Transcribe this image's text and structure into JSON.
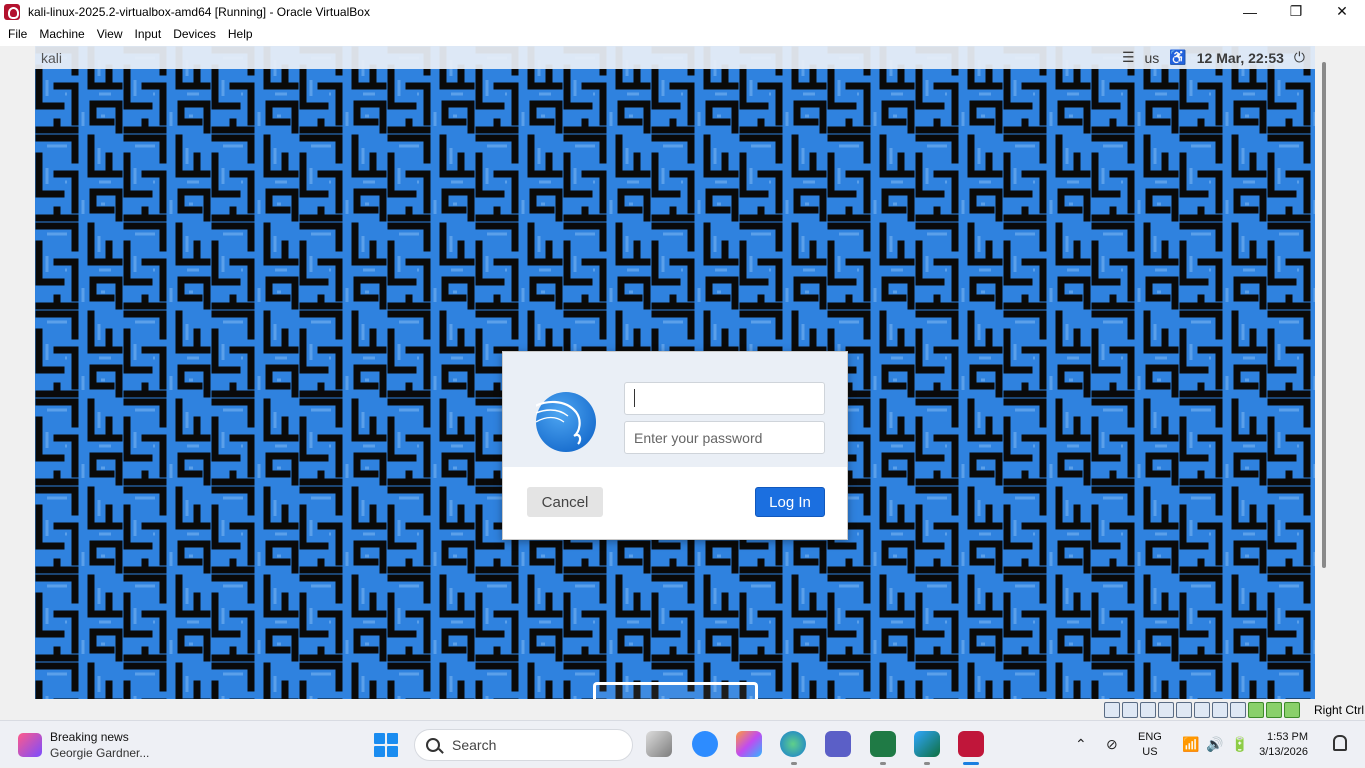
{
  "window": {
    "title": "kali-linux-2025.2-virtualbox-amd64 [Running] - Oracle VirtualBox",
    "controls": {
      "minimize": "—",
      "maximize": "❐",
      "close": "✕"
    }
  },
  "menubar": {
    "items": [
      "File",
      "Machine",
      "View",
      "Input",
      "Devices",
      "Help"
    ]
  },
  "guest": {
    "topbar": {
      "hostname": "kali",
      "keyboard": "us",
      "datetime": "12 Mar, 22:53",
      "menu_icon": "hamburger-icon",
      "accessibility_icon": "accessibility-icon",
      "power_icon": "power-icon"
    },
    "login": {
      "username_value": "",
      "password_placeholder": "Enter your password",
      "cancel_label": "Cancel",
      "login_label": "Log In",
      "logo": "kali-dragon-logo"
    },
    "colors": {
      "maze_blue": "#2f82df",
      "maze_dark": "#0a0a0a",
      "accent": "#1b6fe0"
    }
  },
  "vbox_status": {
    "host_key": "Right Ctrl",
    "icons": [
      "hard-disk-icon",
      "optical-drive-icon",
      "audio-icon",
      "network-icon",
      "usb-icon",
      "shared-folders-icon",
      "display-icon",
      "recording-icon",
      "cpu-icon",
      "mouse-integration-icon",
      "keyboard-icon"
    ]
  },
  "taskbar": {
    "news_title": "Breaking news",
    "news_subtitle": "Georgie Gardner...",
    "search_placeholder": "Search",
    "apps": [
      "task-view-icon",
      "zoom-icon",
      "copilot-icon",
      "edge-icon",
      "teams-icon",
      "excel-icon",
      "vs-code-icon",
      "virtualbox-icon"
    ],
    "language_line1": "ENG",
    "language_line2": "US",
    "time": "1:53 PM",
    "date": "3/13/2026"
  }
}
